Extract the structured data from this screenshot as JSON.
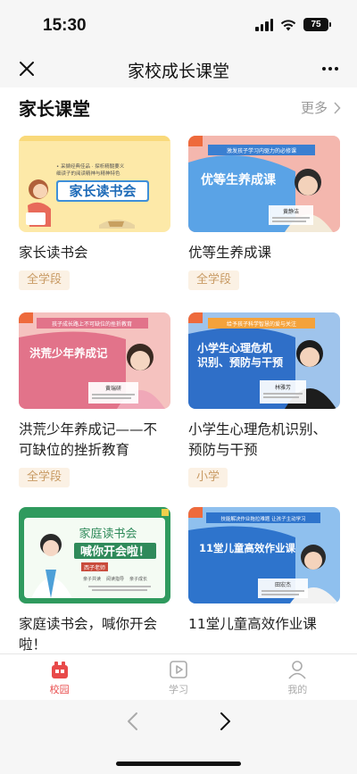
{
  "status_bar": {
    "time": "15:30",
    "battery": "75"
  },
  "nav": {
    "title": "家校成长课堂"
  },
  "section": {
    "title": "家长课堂",
    "more_label": "更多"
  },
  "courses": [
    {
      "title": "家长读书会",
      "tag": "全学段",
      "banner": "家长读书会",
      "subtitle": "• 采撷经典佳品 · 探析精髓要义\n细读子的阅读精神与精神特色"
    },
    {
      "title": "优等生养成课",
      "tag": "全学段",
      "banner": "优等生养成课",
      "ribbon": "激发孩子学习内驱力的必修课",
      "teacher": "黄静洁"
    },
    {
      "title": "洪荒少年养成记——不可缺位的挫折教育",
      "tag": "全学段",
      "banner": "洪荒少年养成记",
      "ribbon": "孩子成长路上不可缺位的挫折教育",
      "teacher": "黄瑞研"
    },
    {
      "title": "小学生心理危机识别、预防与干预",
      "tag": "小学",
      "banner_line1": "小学生心理危机",
      "banner_line2": "识别、预防与干预",
      "ribbon": "给予孩子科学智慧的爱与关注",
      "teacher": "林雅芳"
    },
    {
      "title": "家庭读书会，喊你开会啦！",
      "tag": "",
      "banner_line1": "家庭读书会",
      "banner_line2": "喊你开会啦！",
      "teacher": "西子老师",
      "chips": [
        "亲子共读",
        "阅读指导",
        "亲子成长"
      ]
    },
    {
      "title": "11堂儿童高效作业课",
      "tag": "",
      "banner": "11堂儿童高效作业课",
      "ribbon": "技能解决作业拖拉难题 让孩子主动学习",
      "teacher": "田宏杰"
    }
  ],
  "tabs": [
    {
      "label": "校园",
      "active": true
    },
    {
      "label": "学习",
      "active": false
    },
    {
      "label": "我的",
      "active": false
    }
  ],
  "colors": {
    "accent": "#e84a4a",
    "tag_bg": "#fbf1e4",
    "tag_text": "#c89a63"
  }
}
